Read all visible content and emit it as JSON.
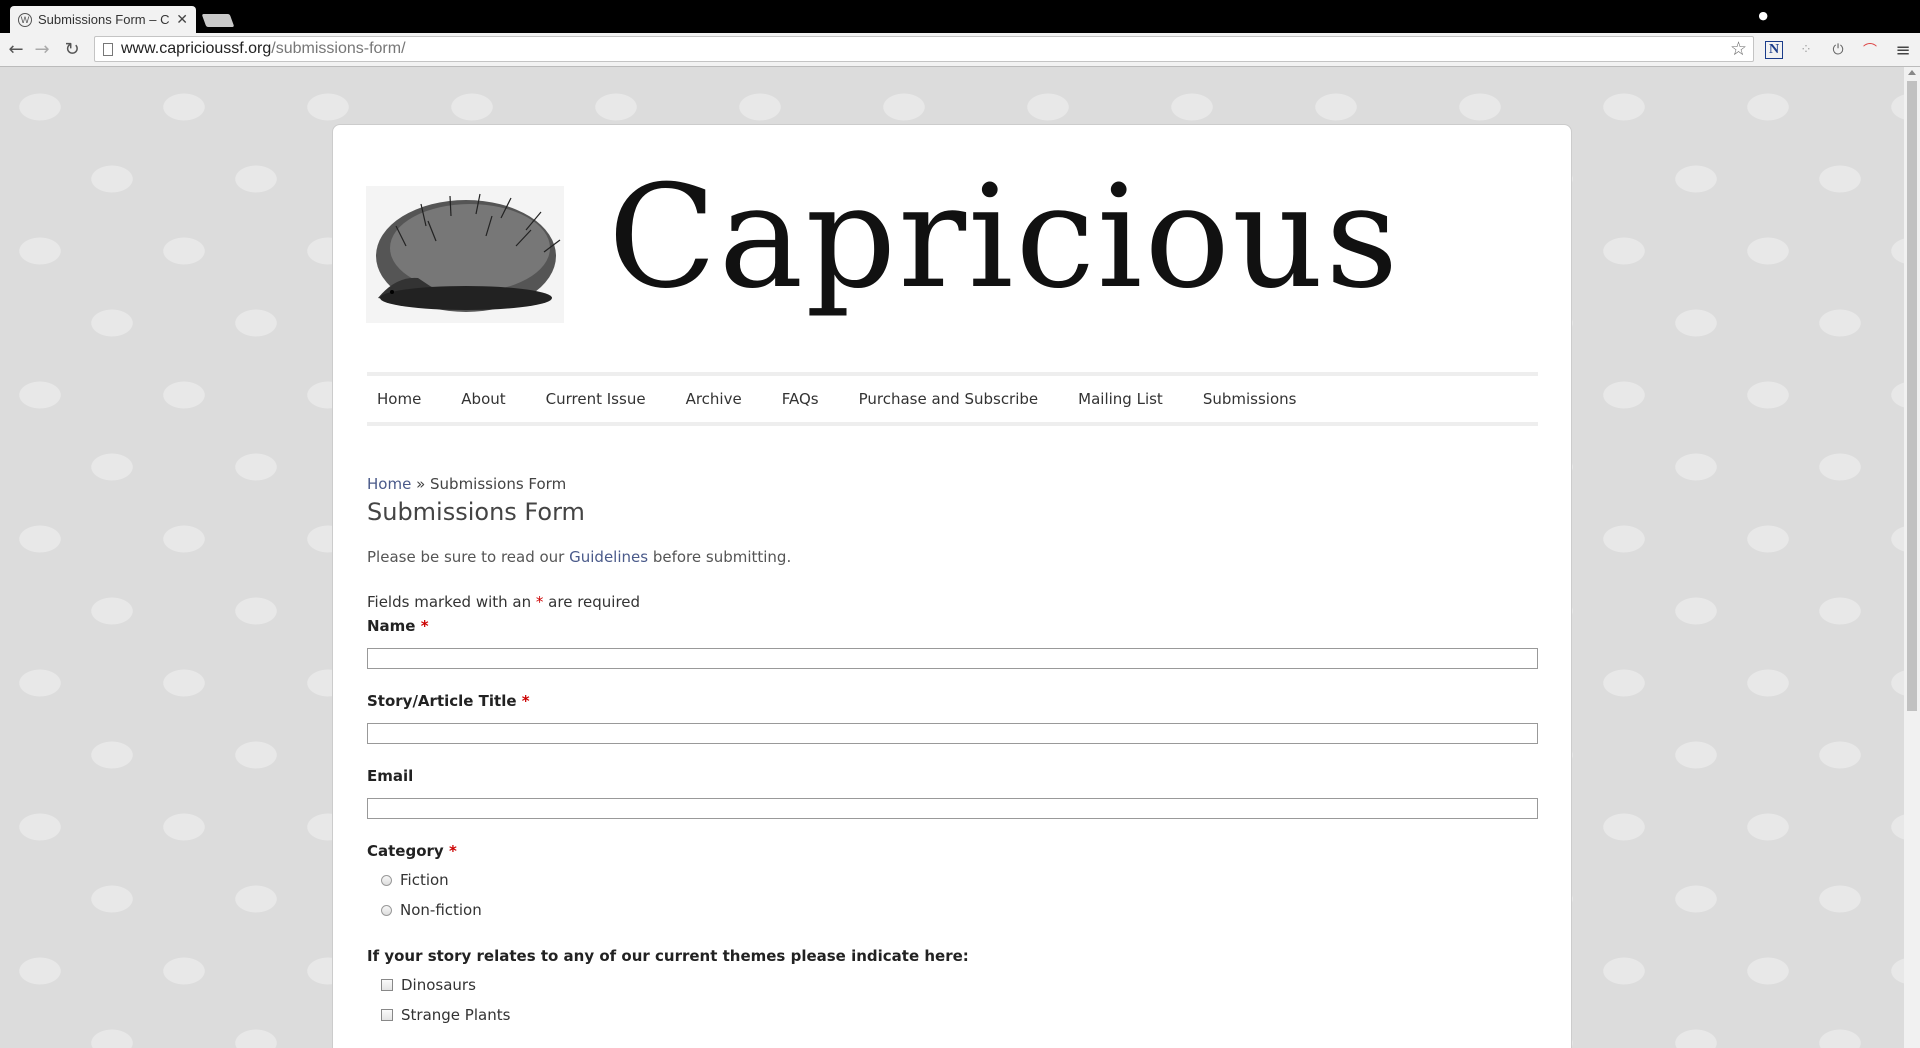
{
  "browser": {
    "tab_title": "Submissions Form – Capricious",
    "tab_close": "✕",
    "url_host": "www.capricioussf.org",
    "url_path": "/submissions-form/"
  },
  "site": {
    "title": "Capricious",
    "nav": [
      "Home",
      "About",
      "Current Issue",
      "Archive",
      "FAQs",
      "Purchase and Subscribe",
      "Mailing List",
      "Submissions"
    ]
  },
  "page": {
    "breadcrumb_home": "Home",
    "breadcrumb_sep": " » ",
    "breadcrumb_current": "Submissions Form",
    "heading": "Submissions Form",
    "intro_before": "Please be sure to read our ",
    "intro_link": "Guidelines",
    "intro_after": " before submitting.",
    "required_before": "Fields marked with an ",
    "required_star": "*",
    "required_after": " are required"
  },
  "form": {
    "name_label": "Name",
    "title_label": "Story/Article Title",
    "email_label": "Email",
    "category_label": "Category",
    "category_options": [
      "Fiction",
      "Non-fiction"
    ],
    "themes_label": "If your story relates to any of our current themes please indicate here:",
    "theme_options": [
      "Dinosaurs",
      "Strange Plants"
    ],
    "required_marker": "*"
  }
}
